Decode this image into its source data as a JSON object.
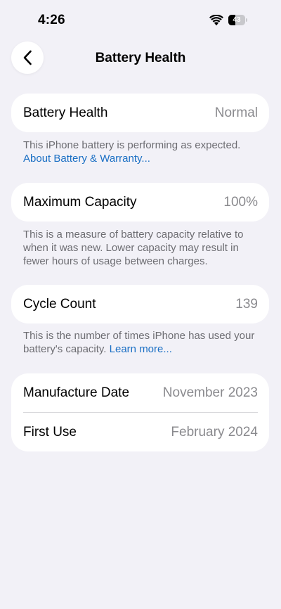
{
  "status_bar": {
    "time": "4:26",
    "battery_level": "43",
    "battery_fill_percent": 43
  },
  "nav": {
    "title": "Battery Health"
  },
  "battery_health": {
    "label": "Battery Health",
    "value": "Normal",
    "description": "This iPhone battery is performing as expected.",
    "link": "About Battery & Warranty..."
  },
  "maximum_capacity": {
    "label": "Maximum Capacity",
    "value": "100%",
    "description": "This is a measure of battery capacity relative to when it was new. Lower capacity may result in fewer hours of usage between charges."
  },
  "cycle_count": {
    "label": "Cycle Count",
    "value": "139",
    "description": "This is the number of times iPhone has used your battery's capacity.",
    "link": "Learn more..."
  },
  "dates": {
    "manufacture_label": "Manufacture Date",
    "manufacture_value": "November 2023",
    "first_use_label": "First Use",
    "first_use_value": "February 2024"
  }
}
